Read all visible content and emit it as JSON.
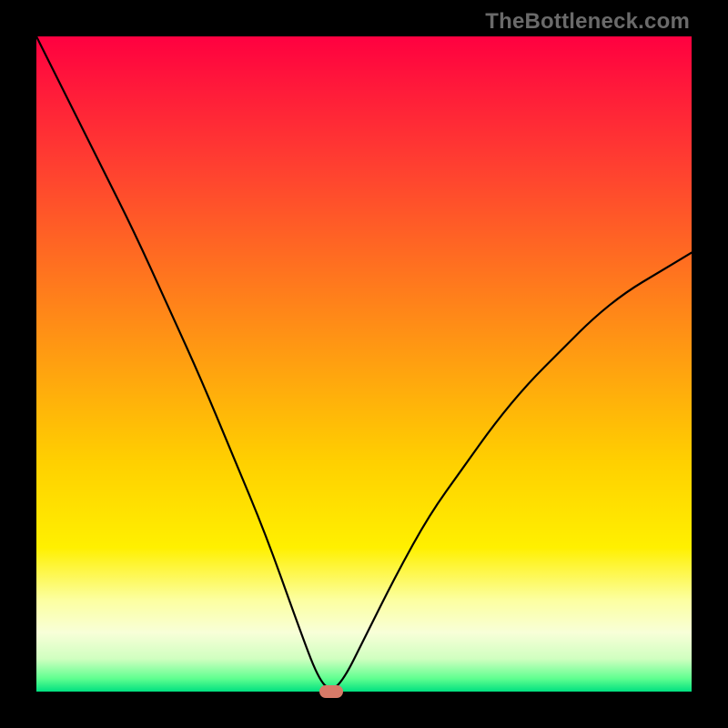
{
  "watermark": "TheBottleneck.com",
  "chart_data": {
    "type": "line",
    "title": "",
    "xlabel": "",
    "ylabel": "",
    "xlim": [
      0,
      100
    ],
    "ylim": [
      0,
      100
    ],
    "grid": false,
    "series": [
      {
        "name": "bottleneck-curve",
        "x": [
          0,
          5,
          10,
          15,
          20,
          25,
          30,
          35,
          40,
          43,
          45,
          47,
          50,
          55,
          60,
          65,
          70,
          75,
          80,
          85,
          90,
          95,
          100
        ],
        "values": [
          100,
          90,
          80,
          70,
          59,
          48,
          36,
          24,
          10,
          2,
          0,
          2,
          8,
          18,
          27,
          34,
          41,
          47,
          52,
          57,
          61,
          64,
          67
        ]
      }
    ],
    "marker": {
      "x": 45,
      "y": 0,
      "color": "#d87a68"
    },
    "background_gradient": {
      "top": "#ff0040",
      "mid": "#ffd000",
      "bottom": "#00e080"
    }
  }
}
